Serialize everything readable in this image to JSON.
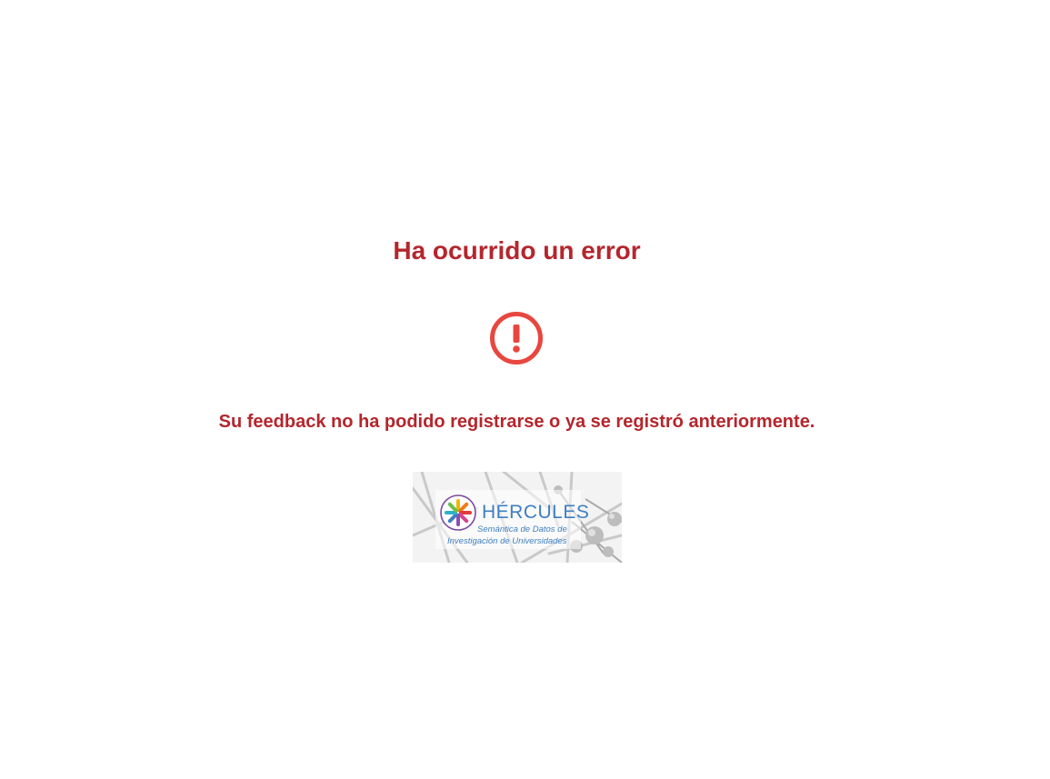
{
  "error": {
    "title": "Ha ocurrido un error",
    "message": "Su feedback no ha podido registrarse o ya se registró anteriormente.",
    "icon": "exclamation-circle-icon",
    "color": "#b5262d",
    "icon_color": "#e8473f"
  },
  "logo": {
    "name": "HÉRCULES",
    "subtitle_line1": "Semántica de Datos de",
    "subtitle_line2": "Investigación de Universidades"
  }
}
